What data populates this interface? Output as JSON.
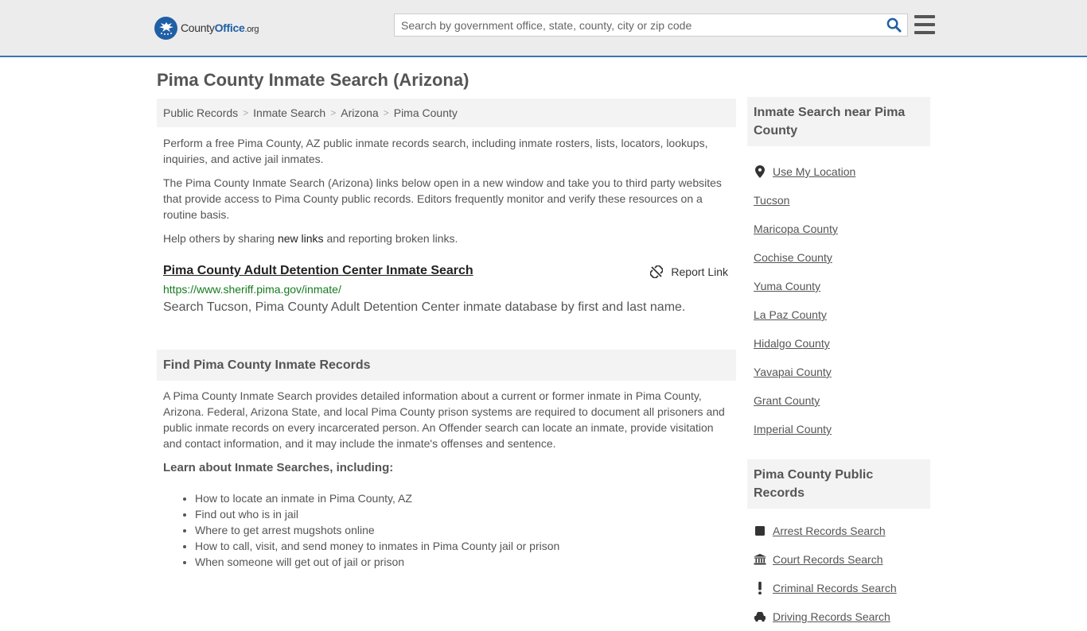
{
  "header": {
    "logo_brand": "CountyOffice",
    "logo_county": "County",
    "logo_office": "Office",
    "logo_tld": ".org",
    "search_placeholder": "Search by government office, state, county, city or zip code"
  },
  "page_title": "Pima County Inmate Search (Arizona)",
  "breadcrumb": [
    "Public Records",
    "Inmate Search",
    "Arizona",
    "Pima County"
  ],
  "intro": {
    "p1": "Perform a free Pima County, AZ public inmate records search, including inmate rosters, lists, locators, lookups, inquiries, and active jail inmates.",
    "p2": "The Pima County Inmate Search (Arizona) links below open in a new window and take you to third party websites that provide access to Pima County public records. Editors frequently monitor and verify these resources on a routine basis.",
    "p3_before": "Help others by sharing ",
    "p3_link": "new links",
    "p3_after": " and reporting broken links."
  },
  "result": {
    "title": "Pima County Adult Detention Center Inmate Search",
    "report_label": "Report Link",
    "url": "https://www.sheriff.pima.gov/inmate/",
    "description": "Search Tucson, Pima County Adult Detention Center inmate database by first and last name."
  },
  "find_section": {
    "heading": "Find Pima County Inmate Records",
    "body": "A Pima County Inmate Search provides detailed information about a current or former inmate in Pima County, Arizona. Federal, Arizona State, and local Pima County prison systems are required to document all prisoners and public inmate records on every incarcerated person. An Offender search can locate an inmate, provide visitation and contact information, and it may include the inmate's offenses and sentence.",
    "learn_heading": "Learn about Inmate Searches, including:",
    "bullets": [
      "How to locate an inmate in Pima County, AZ",
      "Find out who is in jail",
      "Where to get arrest mugshots online",
      "How to call, visit, and send money to inmates in Pima County jail or prison",
      "When someone will get out of jail or prison"
    ]
  },
  "sidebar": {
    "nearby_heading": "Inmate Search near Pima County",
    "use_location": "Use My Location",
    "nearby": [
      "Tucson",
      "Maricopa County",
      "Cochise County",
      "Yuma County",
      "La Paz County",
      "Hidalgo County",
      "Yavapai County",
      "Grant County",
      "Imperial County"
    ],
    "records_heading": "Pima County Public Records",
    "records": [
      {
        "label": "Arrest Records Search",
        "icon": "square-icon"
      },
      {
        "label": "Court Records Search",
        "icon": "courthouse-icon"
      },
      {
        "label": "Criminal Records Search",
        "icon": "exclamation-icon"
      },
      {
        "label": "Driving Records Search",
        "icon": "car-icon"
      }
    ]
  },
  "colors": {
    "header_bg": "#ececec",
    "header_border": "#3b74b7",
    "brand_blue": "#1f5fa6",
    "url_green": "#157b1e",
    "panel_bg": "#f3f3f3"
  }
}
